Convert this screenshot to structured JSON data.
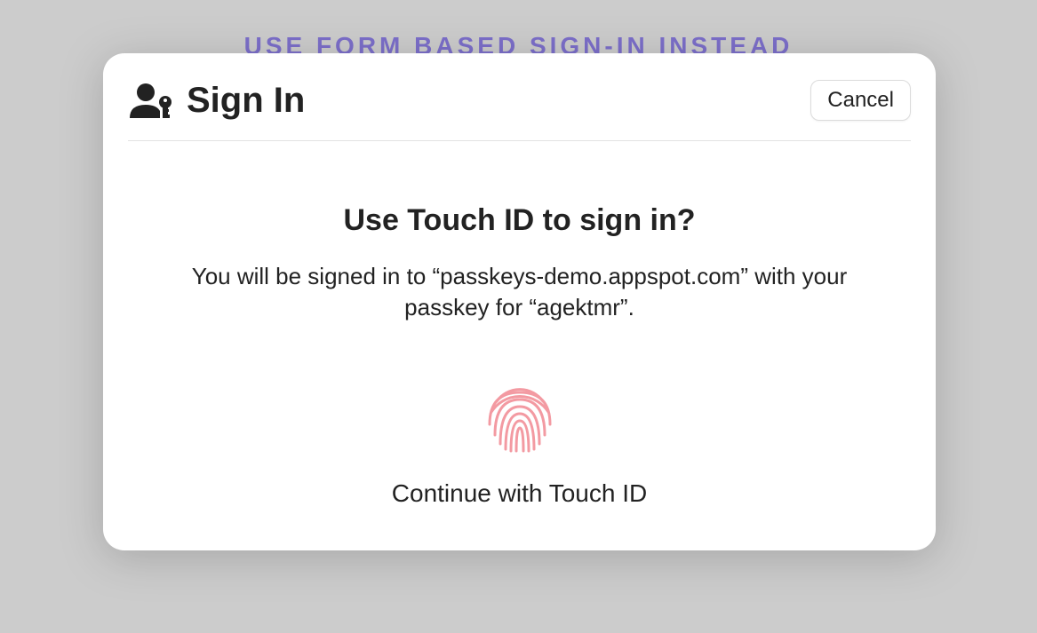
{
  "background_link": {
    "label": "USE FORM BASED SIGN-IN INSTEAD"
  },
  "dialog": {
    "title": "Sign In",
    "cancel_label": "Cancel",
    "heading": "Use Touch ID to sign in?",
    "description": "You will be signed in to “passkeys-demo.appspot.com” with your passkey for “agektmr”.",
    "continue_label": "Continue with Touch ID"
  },
  "colors": {
    "link": "#7c6fca",
    "fingerprint": "#f39aa2"
  }
}
